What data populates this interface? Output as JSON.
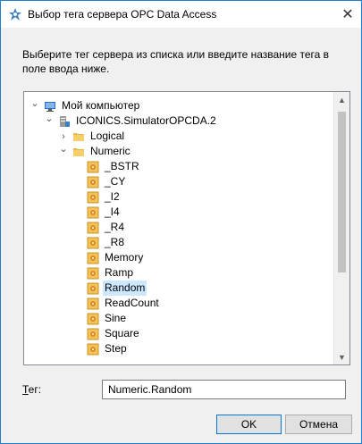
{
  "window": {
    "title": "Выбор тега сервера OPC Data Access",
    "close_glyph": "✕"
  },
  "instruction": "Выберите тег сервера из списка или введите название тега в поле ввода ниже.",
  "tree": {
    "nodes": [
      {
        "label": "Мой компьютер",
        "icon": "computer-icon",
        "expander": "expanded"
      },
      {
        "label": "ICONICS.SimulatorOPCDA.2",
        "icon": "server-icon",
        "expander": "expanded"
      },
      {
        "label": "Logical",
        "icon": "folder-icon",
        "expander": "collapsed"
      },
      {
        "label": "Numeric",
        "icon": "folder-icon",
        "expander": "expanded"
      },
      {
        "label": "_BSTR",
        "icon": "tag-icon"
      },
      {
        "label": "_CY",
        "icon": "tag-icon"
      },
      {
        "label": "_I2",
        "icon": "tag-icon"
      },
      {
        "label": "_I4",
        "icon": "tag-icon"
      },
      {
        "label": "_R4",
        "icon": "tag-icon"
      },
      {
        "label": "_R8",
        "icon": "tag-icon"
      },
      {
        "label": "Memory",
        "icon": "tag-icon"
      },
      {
        "label": "Ramp",
        "icon": "tag-icon"
      },
      {
        "label": "Random",
        "icon": "tag-icon",
        "selected": true
      },
      {
        "label": "ReadCount",
        "icon": "tag-icon"
      },
      {
        "label": "Sine",
        "icon": "tag-icon"
      },
      {
        "label": "Square",
        "icon": "tag-icon"
      },
      {
        "label": "Step",
        "icon": "tag-icon"
      }
    ]
  },
  "tag_field": {
    "label_first": "Т",
    "label_rest": "ег:",
    "value": "Numeric.Random"
  },
  "buttons": {
    "ok": "OK",
    "cancel": "Отмена"
  },
  "colors": {
    "selection": "#cce8ff",
    "accent": "#0078d7",
    "folder": "#e8b84a"
  }
}
